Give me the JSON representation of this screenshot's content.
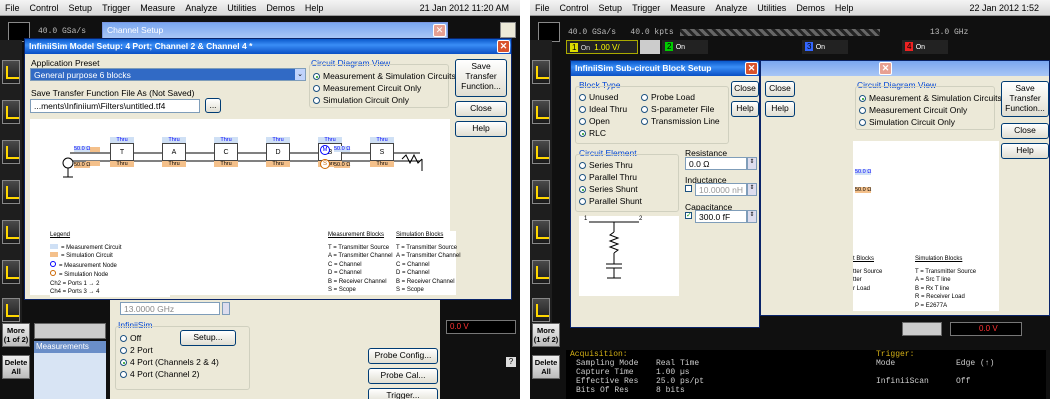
{
  "left": {
    "menu": [
      "File",
      "Control",
      "Setup",
      "Trigger",
      "Measure",
      "Analyze",
      "Utilities",
      "Demos",
      "Help"
    ],
    "date": "21 Jan 2012 11:20 AM",
    "sample_rate": "40.0 GSa/s",
    "channel_setup_title": "Channel Setup",
    "model_dialog": {
      "title": "InfiniiSim Model Setup: 4 Port; Channel 2 & Channel 4 *",
      "app_preset_label": "Application Preset",
      "app_preset_value": "General purpose 6 blocks",
      "save_tf_label": "Save Transfer Function File As (Not Saved)",
      "save_tf_value": "...ments\\Infiniium\\Filters\\untitled.tf4",
      "browse": "...",
      "circuit_view_label": "Circuit Diagram View",
      "circuit_view_options": [
        "Measurement & Simulation Circuits",
        "Measurement Circuit Only",
        "Simulation Circuit Only"
      ],
      "save_btn": "Save Transfer Function...",
      "close_btn": "Close",
      "help_btn": "Help"
    },
    "diagram": {
      "blocks": [
        {
          "top": "Thru",
          "mid": "T",
          "bot": "Thru"
        },
        {
          "top": "Thru",
          "mid": "A",
          "bot": "Thru"
        },
        {
          "top": "Thru",
          "mid": "C",
          "bot": "Thru"
        },
        {
          "top": "Thru",
          "mid": "D",
          "bot": "Thru"
        },
        {
          "top": "Thru",
          "mid": "B",
          "bot": "Thru"
        },
        {
          "top": "Thru",
          "mid": "S",
          "bot": "Thru"
        }
      ],
      "src_r1": "50.0 Ω",
      "src_r2": "50.0 Ω",
      "load_r1": "50.0 Ω",
      "load_r2": "50.0 Ω",
      "node_m": "M",
      "node_s": "S"
    },
    "legend": {
      "title": "Legend",
      "items": [
        "= Measurement Circuit",
        "= Simulation Circuit",
        "= Measurement Node",
        "= Simulation Node",
        "Ch2 = Ports 1 → 2",
        "Ch4 = Ports 3 → 4"
      ],
      "meas_title": "Measurement Blocks",
      "meas_items": [
        "T = Transmitter Source",
        "A = Transmitter Channel",
        "C = Channel",
        "D = Channel",
        "B = Receiver Channel",
        "S = Scope"
      ],
      "sim_title": "Simulation Blocks",
      "sim_items": [
        "T = Transmitter Source",
        "A = Transmitter Channel",
        "C = Channel",
        "D = Channel",
        "B = Receiver Channel",
        "S = Scope"
      ]
    },
    "lower": {
      "freq": "13.0000 GHz",
      "infiniisim_label": "InfiniiSim",
      "options": [
        "Off",
        "2 Port",
        "4 Port (Channels 2 & 4)",
        "4 Port (Channel 2)"
      ],
      "setup_btn": "Setup...",
      "probe_config": "Probe Config...",
      "probe_cal": "Probe Cal...",
      "trigger": "Trigger..."
    },
    "more": "More (1 of 2)",
    "delete": "Delete All",
    "measurements": "Measurements",
    "ch_value": "0.0 V"
  },
  "right": {
    "menu": [
      "File",
      "Control",
      "Setup",
      "Trigger",
      "Measure",
      "Analyze",
      "Utilities",
      "Demos",
      "Help"
    ],
    "date": "22 Jan 2012 1:52",
    "sample_rate": "40.0 GSa/s   40.0 kpts",
    "bandwidth": "13.0 GHz",
    "ch1_val": "1.00 V/",
    "on": "On",
    "ch_nums": [
      "1",
      "2",
      "3",
      "4"
    ],
    "sub_dialog": {
      "title": "InfiniiSim Sub-circuit Block Setup",
      "block_type_label": "Block Type",
      "block_types_left": [
        "Unused",
        "Ideal Thru",
        "Open",
        "RLC"
      ],
      "block_types_right": [
        "Probe Load",
        "S-parameter File",
        "Transmission Line"
      ],
      "circuit_element_label": "Circuit Element",
      "circuit_elements": [
        "Series Thru",
        "Parallel Thru",
        "Series Shunt",
        "Parallel Shunt"
      ],
      "resistance_label": "Resistance",
      "resistance": "0.0 Ω",
      "inductance_label": "Inductance",
      "inductance": "10.0000 nH",
      "capacitance_label": "Capacitance",
      "capacitance": "300.0 fF",
      "port1": "1",
      "port2": "2",
      "close_btn": "Close",
      "help_btn": "Help"
    },
    "bg_dialog": {
      "close_btn": "Close",
      "help_btn": "Help",
      "circuit_view_label": "Circuit Diagram View",
      "circuit_view_options": [
        "Measurement & Simulation Circuits",
        "Measurement Circuit Only",
        "Simulation Circuit Only"
      ],
      "save_btn": "Save Transfer Function...",
      "close2_btn": "Close",
      "help2_btn": "Help",
      "r1": "50.0 Ω",
      "r2": "50.0 Ω",
      "meas_title": "t Blocks",
      "meas_items": [
        "tter Source",
        "tter",
        "",
        "r Load"
      ],
      "sim_title": "Simulation Blocks",
      "sim_items": [
        "T = Transmitter Source",
        "A = Src T line",
        "B = Rx T line",
        "R = Receiver Load",
        "P = E2677A"
      ]
    },
    "status": {
      "acq_label": "Acquisition:",
      "rows": [
        [
          "Sampling Mode",
          "Real Time"
        ],
        [
          "Capture Time",
          "1.00 µs"
        ],
        [
          "Effective Res",
          "25.0 ps/pt"
        ],
        [
          "Bits Of Res",
          "8 bits"
        ]
      ],
      "trig_label": "Trigger:",
      "trig_rows": [
        [
          "Mode",
          "Edge (↑)"
        ],
        [
          "",
          ""
        ],
        [
          "InfiniiScan",
          "Off"
        ]
      ]
    },
    "ch_value": "0.0 V",
    "more": "More (1 of 2)",
    "delete": "Delete All"
  }
}
